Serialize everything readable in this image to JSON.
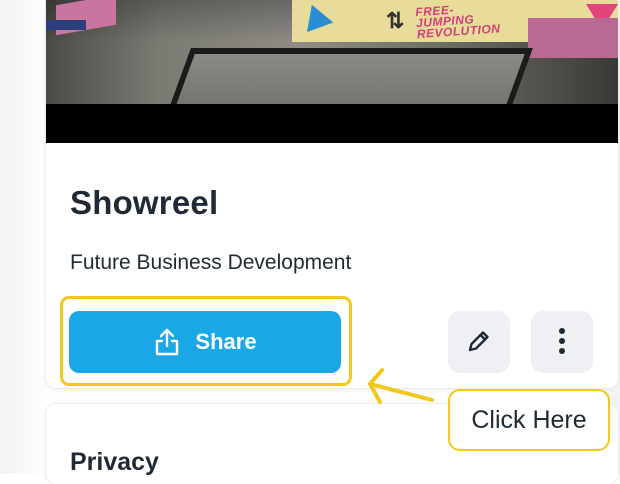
{
  "video": {
    "banner_lines": [
      "FREE-",
      "JUMPING",
      "REVOLUTION"
    ]
  },
  "card": {
    "title": "Showreel",
    "subtitle": "Future Business Development"
  },
  "actions": {
    "share_label": "Share",
    "share_icon": "share-upload-icon",
    "edit_icon": "pencil-icon",
    "more_icon": "vertical-dots-icon"
  },
  "privacy": {
    "title": "Privacy"
  },
  "callout": {
    "text": "Click Here"
  },
  "colors": {
    "primary": "#1aa7e6",
    "highlight": "#f3c81a",
    "text": "#1f2a36",
    "icon_button_bg": "#eef0f3"
  }
}
